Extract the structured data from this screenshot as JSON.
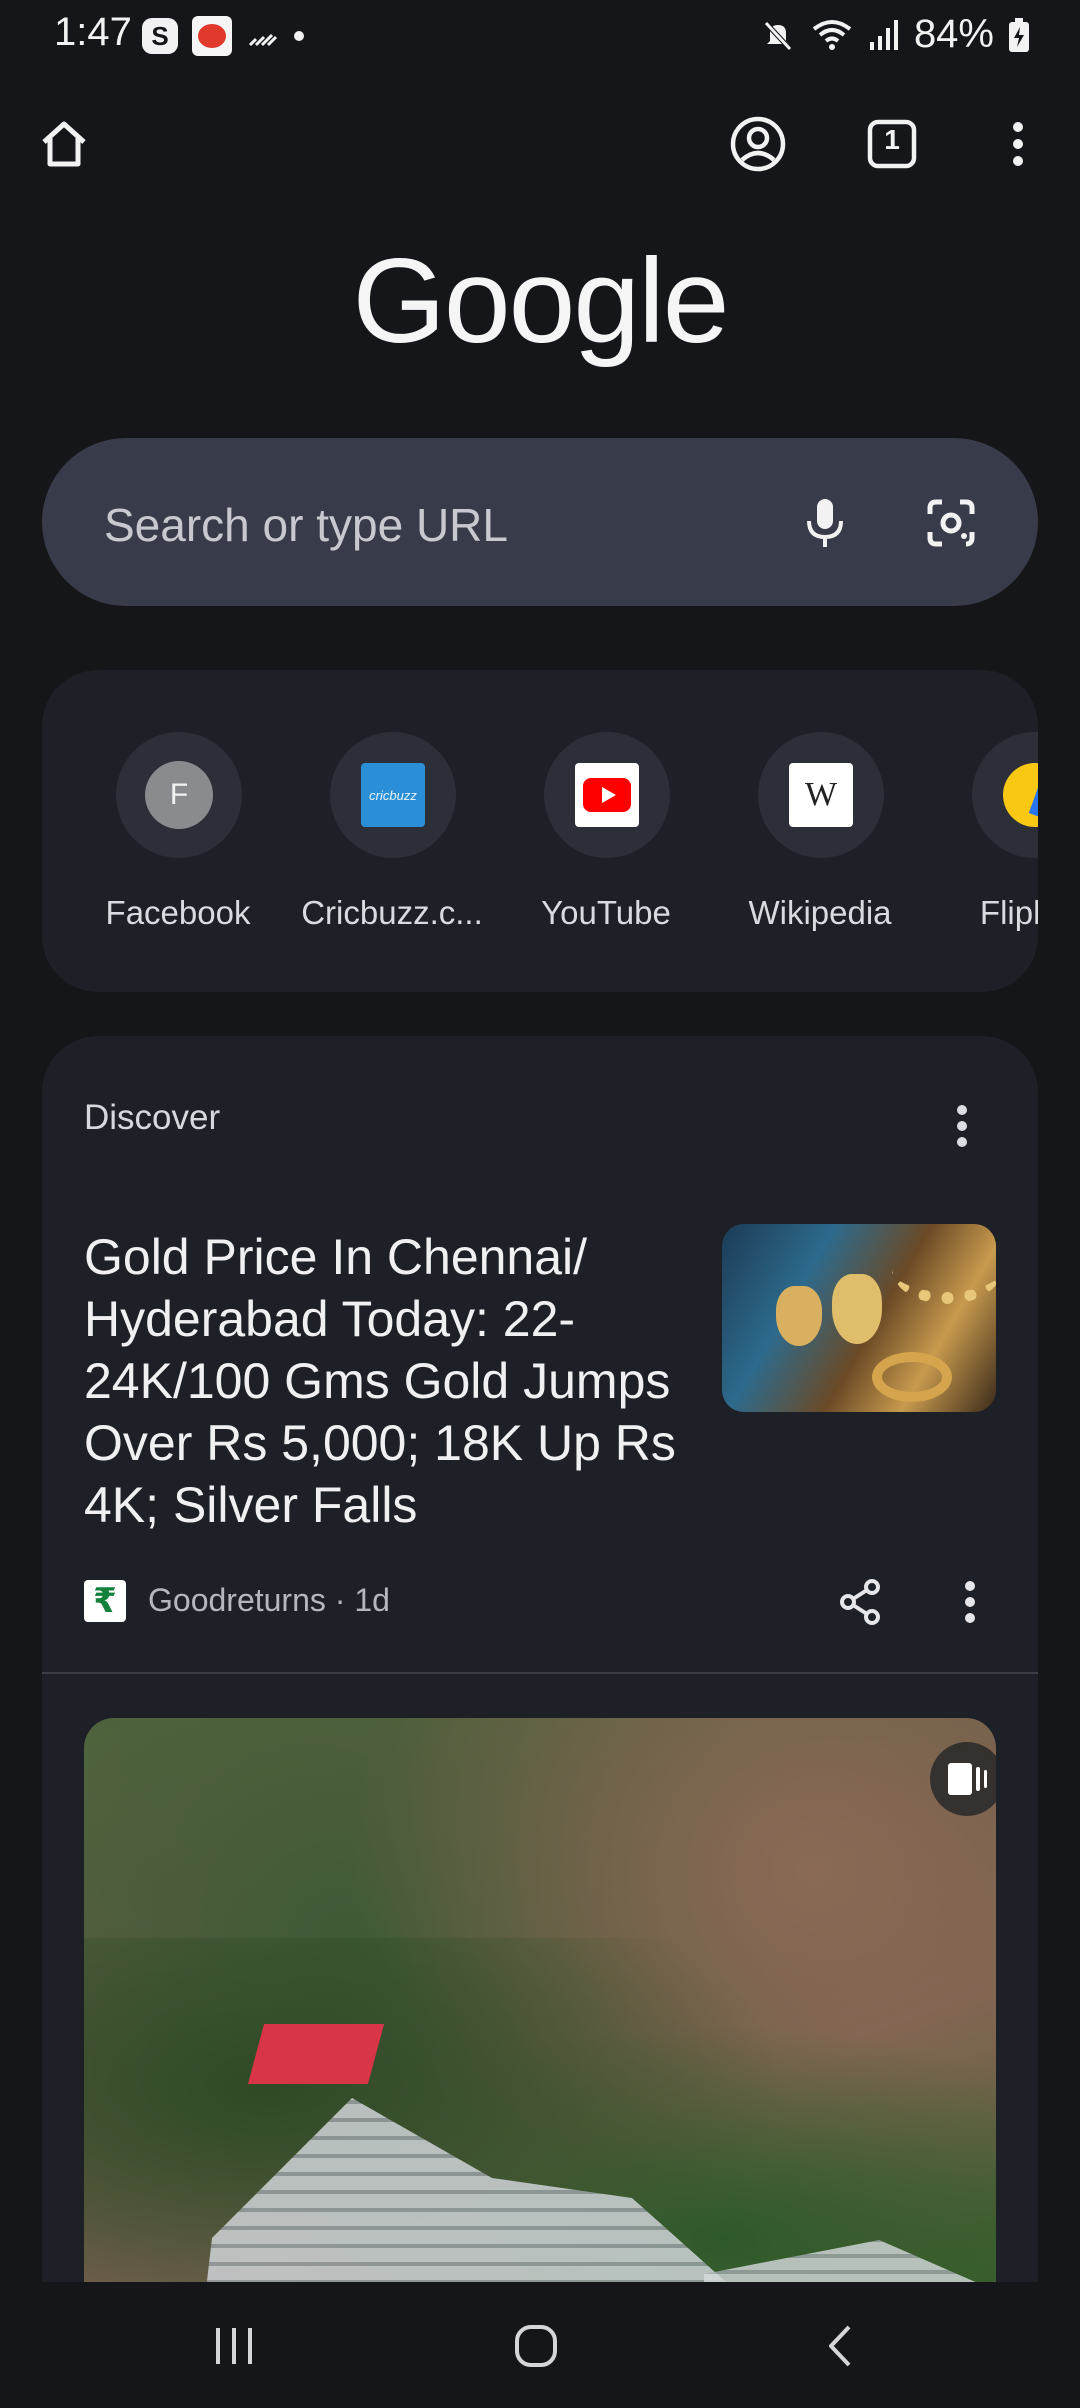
{
  "status_bar": {
    "time": "1:47",
    "s_badge": "S",
    "battery": "84%",
    "icons": [
      "s-app-icon",
      "news-app-icon",
      "signal-slash-icon",
      "notification-dot",
      "mute-icon",
      "wifi-icon",
      "cell-signal-icon",
      "battery-charging-icon"
    ]
  },
  "toolbar": {
    "tab_count": "1",
    "icons": [
      "home-icon",
      "account-icon",
      "tab-switcher-icon",
      "more-vert-icon"
    ]
  },
  "logo": {
    "text": "Google"
  },
  "search": {
    "placeholder": "Search or type URL",
    "icons": [
      "mic-icon",
      "lens-icon"
    ]
  },
  "shortcuts": [
    {
      "label": "Facebook",
      "initial": "F",
      "icon": "facebook-favicon"
    },
    {
      "label": "Cricbuzz.c...",
      "initial": "cricbuzz",
      "icon": "cricbuzz-favicon"
    },
    {
      "label": "YouTube",
      "icon": "youtube-favicon"
    },
    {
      "label": "Wikipedia",
      "initial": "W",
      "icon": "wikipedia-favicon"
    },
    {
      "label": "Flipkart",
      "icon": "flipkart-favicon"
    }
  ],
  "discover": {
    "title": "Discover",
    "articles": [
      {
        "headline": "Gold Price In Chennai/ Hyderabad Today: 22-24K/100 Gms Gold Jumps Over Rs 5,000; 18K Up Rs 4K; Silver Falls",
        "source": "Goodreturns · 1d",
        "source_icon_text": "₹"
      }
    ]
  },
  "nav_bar": {
    "icons": [
      "recents-icon",
      "home-circle-icon",
      "back-icon"
    ]
  },
  "colors": {
    "background": "#15161a",
    "surface": "#1e2027",
    "search_bg": "#383c4a",
    "youtube_red": "#ff0000",
    "cricbuzz_blue": "#2a8fd6"
  }
}
